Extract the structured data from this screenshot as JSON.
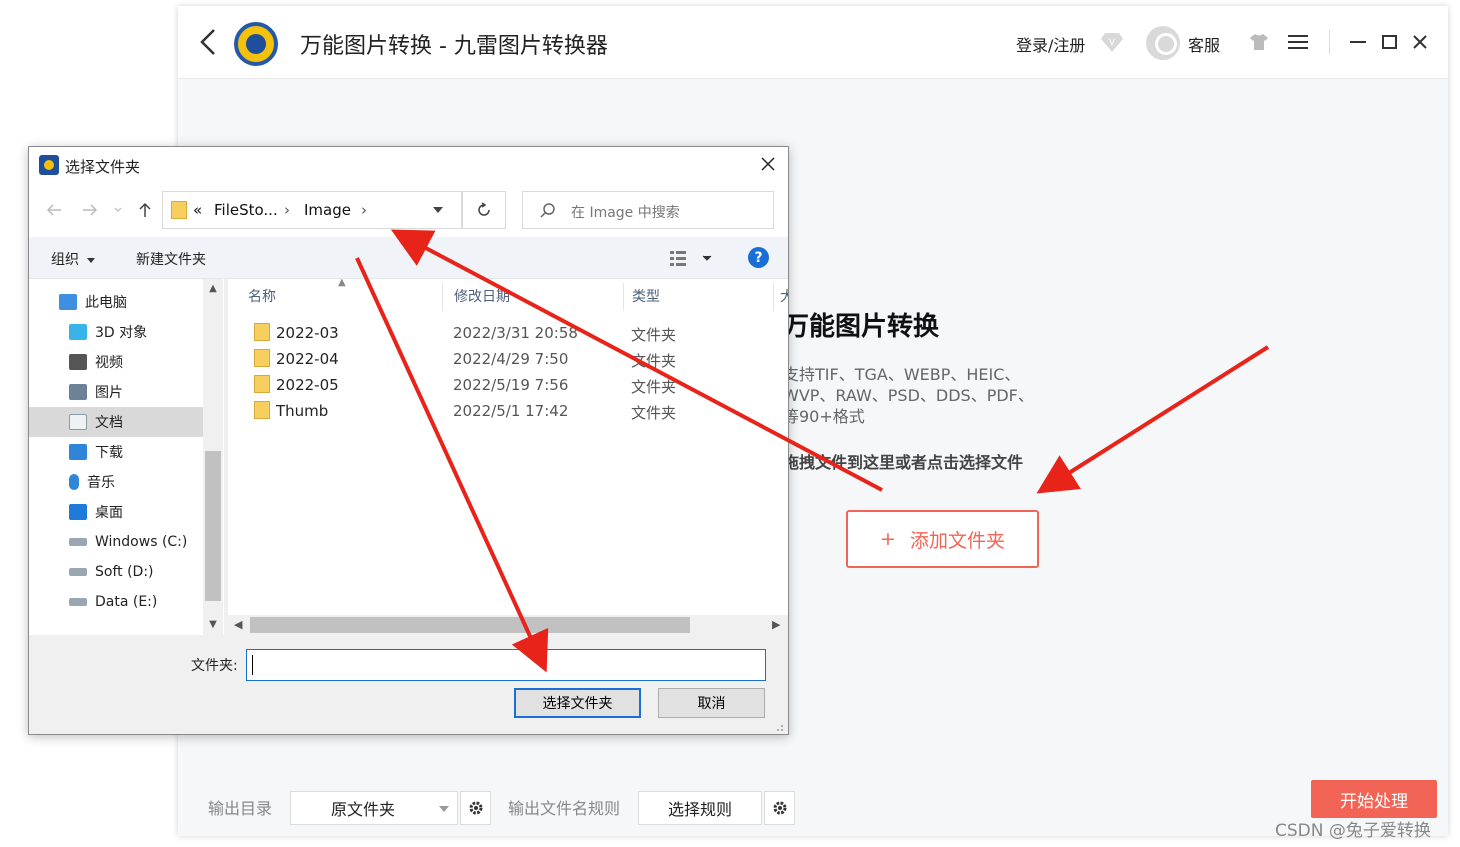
{
  "app": {
    "title": "万能图片转换 - 九雷图片转换器",
    "login_label": "登录/注册",
    "service_label": "客服",
    "main_heading": "万能图片转换",
    "support_lines": [
      "支持TIF、TGA、WEBP、HEIC、",
      "WVP、RAW、PSD、DDS、PDF、",
      "等90+格式"
    ],
    "drag_hint": "拖拽文件到这里或者点击选择文件",
    "add_folder_plus": "+",
    "add_folder_label": "添加文件夹",
    "output_dir_label": "输出目录",
    "output_dir_value": "原文件夹",
    "rule_label": "输出文件名规则",
    "rule_button": "选择规则",
    "start_button": "开始处理",
    "accent_color": "#f26455"
  },
  "dialog": {
    "title": "选择文件夹",
    "breadcrumb": {
      "overflow": "«",
      "segments": [
        "FileSto...",
        "Image"
      ]
    },
    "search_placeholder": "在 Image 中搜索",
    "organize_label": "组织",
    "new_folder_label": "新建文件夹",
    "help_label": "?",
    "nav_items": [
      {
        "label": "此电脑",
        "icon": "computer-icon"
      },
      {
        "label": "3D 对象",
        "icon": "cube-icon"
      },
      {
        "label": "视频",
        "icon": "video-icon"
      },
      {
        "label": "图片",
        "icon": "picture-icon"
      },
      {
        "label": "文档",
        "icon": "document-icon",
        "selected": true
      },
      {
        "label": "下载",
        "icon": "download-icon"
      },
      {
        "label": "音乐",
        "icon": "music-icon"
      },
      {
        "label": "桌面",
        "icon": "desktop-icon"
      },
      {
        "label": "Windows (C:)",
        "icon": "drive-icon"
      },
      {
        "label": "Soft (D:)",
        "icon": "drive-icon"
      },
      {
        "label": "Data (E:)",
        "icon": "drive-icon"
      }
    ],
    "columns": {
      "name": "名称",
      "date": "修改日期",
      "type": "类型",
      "size": "大"
    },
    "files": [
      {
        "name": "2022-03",
        "date": "2022/3/31 20:58",
        "type": "文件夹"
      },
      {
        "name": "2022-04",
        "date": "2022/4/29 7:50",
        "type": "文件夹"
      },
      {
        "name": "2022-05",
        "date": "2022/5/19 7:56",
        "type": "文件夹"
      },
      {
        "name": "Thumb",
        "date": "2022/5/1 17:42",
        "type": "文件夹"
      }
    ],
    "folder_field_label": "文件夹:",
    "folder_field_value": "",
    "ok_button": "选择文件夹",
    "cancel_button": "取消"
  },
  "watermark": "CSDN @兔子爱转换",
  "annotation_color": "#e8231a"
}
